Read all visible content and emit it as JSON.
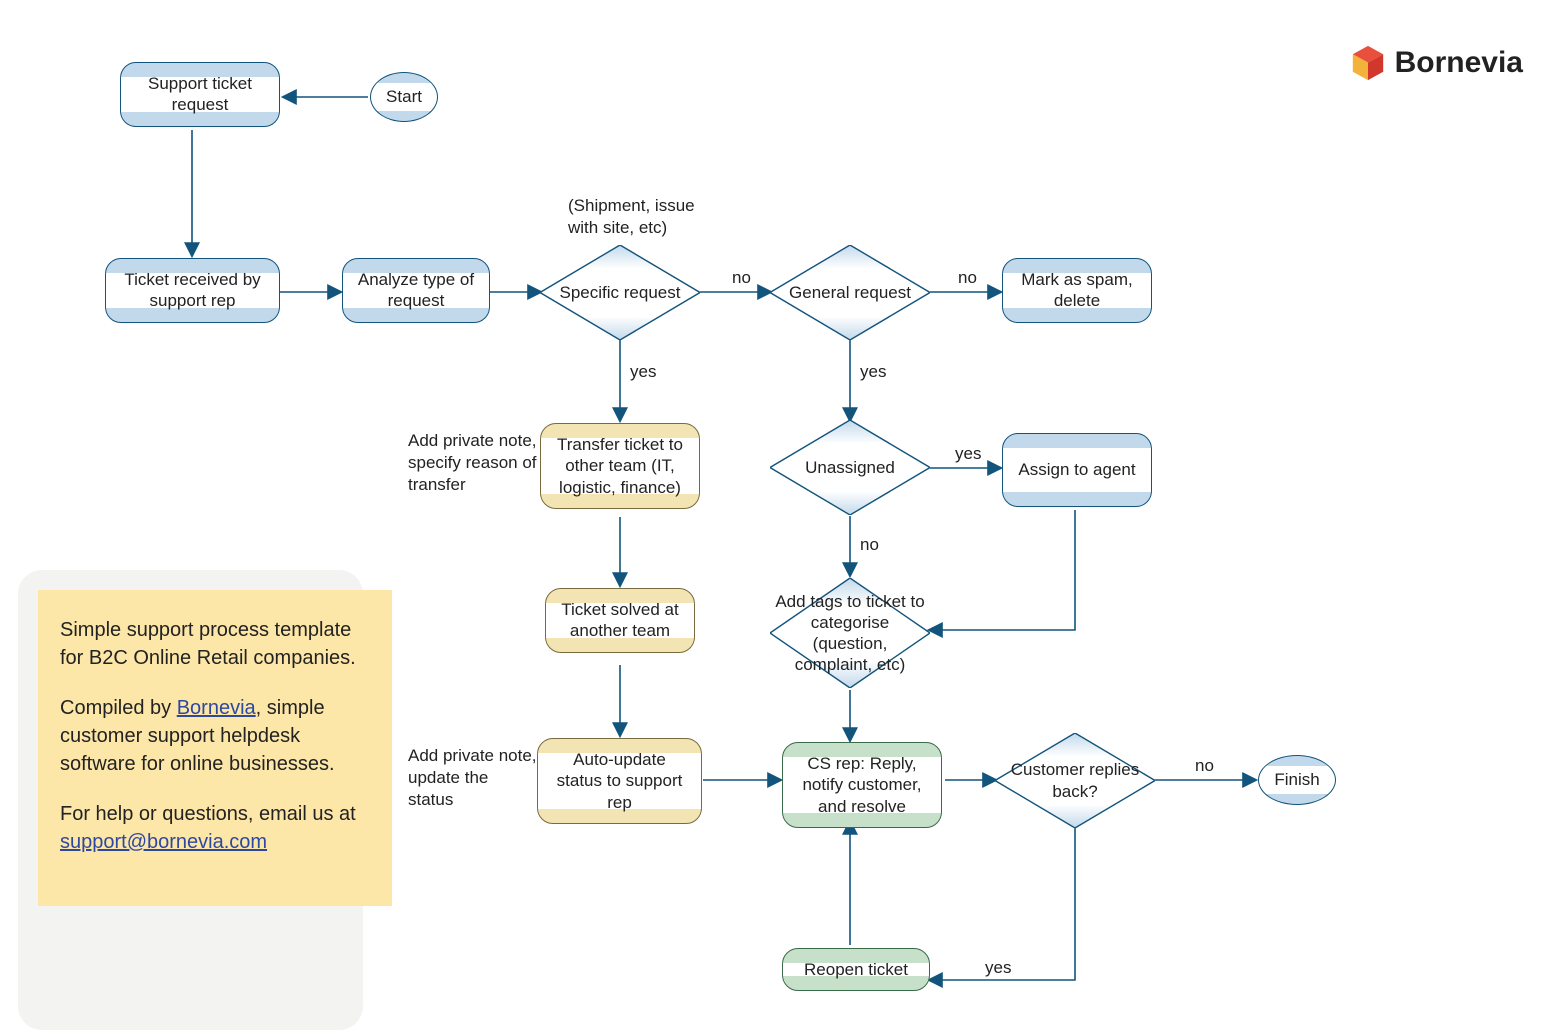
{
  "brand": {
    "name": "Bornevia"
  },
  "nodes": {
    "start": {
      "label": "Start"
    },
    "support_ticket": {
      "label": "Support ticket request"
    },
    "ticket_received": {
      "label": "Ticket received by support rep"
    },
    "analyze": {
      "label": "Analyze type of request"
    },
    "specific_request": {
      "label": "Specific request",
      "note": "(Shipment, issue with site, etc)"
    },
    "general_request": {
      "label": "General request"
    },
    "mark_spam": {
      "label": "Mark as spam, delete"
    },
    "transfer_team": {
      "label": "Transfer ticket to other team (IT, logistic, finance)",
      "note": "Add private note, specify reason of transfer"
    },
    "solved_other": {
      "label": "Ticket solved at another team"
    },
    "auto_update": {
      "label": "Auto-update status to support rep",
      "note": "Add private note, update the status"
    },
    "unassigned": {
      "label": "Unassigned"
    },
    "assign_agent": {
      "label": "Assign to agent"
    },
    "add_tags": {
      "label": "Add tags to ticket to categorise (question, complaint, etc)"
    },
    "cs_reply": {
      "label": "CS rep: Reply, notify customer, and resolve"
    },
    "replies_back": {
      "label": "Customer replies back?"
    },
    "reopen": {
      "label": "Reopen ticket"
    },
    "finish": {
      "label": "Finish"
    }
  },
  "edge_labels": {
    "specific_no": "no",
    "specific_yes": "yes",
    "general_no": "no",
    "general_yes": "yes",
    "unassigned_yes": "yes",
    "unassigned_no": "no",
    "replies_no": "no",
    "replies_yes": "yes"
  },
  "info": {
    "p1": "Simple support process template for B2C Online Retail companies.",
    "p2a": "Compiled by ",
    "p2_link_text": "Bornevia",
    "p2b": ", simple customer support helpdesk software for online businesses.",
    "p3a": "For help or questions, email us at ",
    "p3_link_text": "support@bornevia.com"
  },
  "colors": {
    "blue_border": "#12547c",
    "blue_fill": "#c2d9eb",
    "yellow_fill": "#f3e5b3",
    "green_fill": "#c7e0c9",
    "note_bg": "#fde7a8",
    "link": "#2d48a1"
  }
}
